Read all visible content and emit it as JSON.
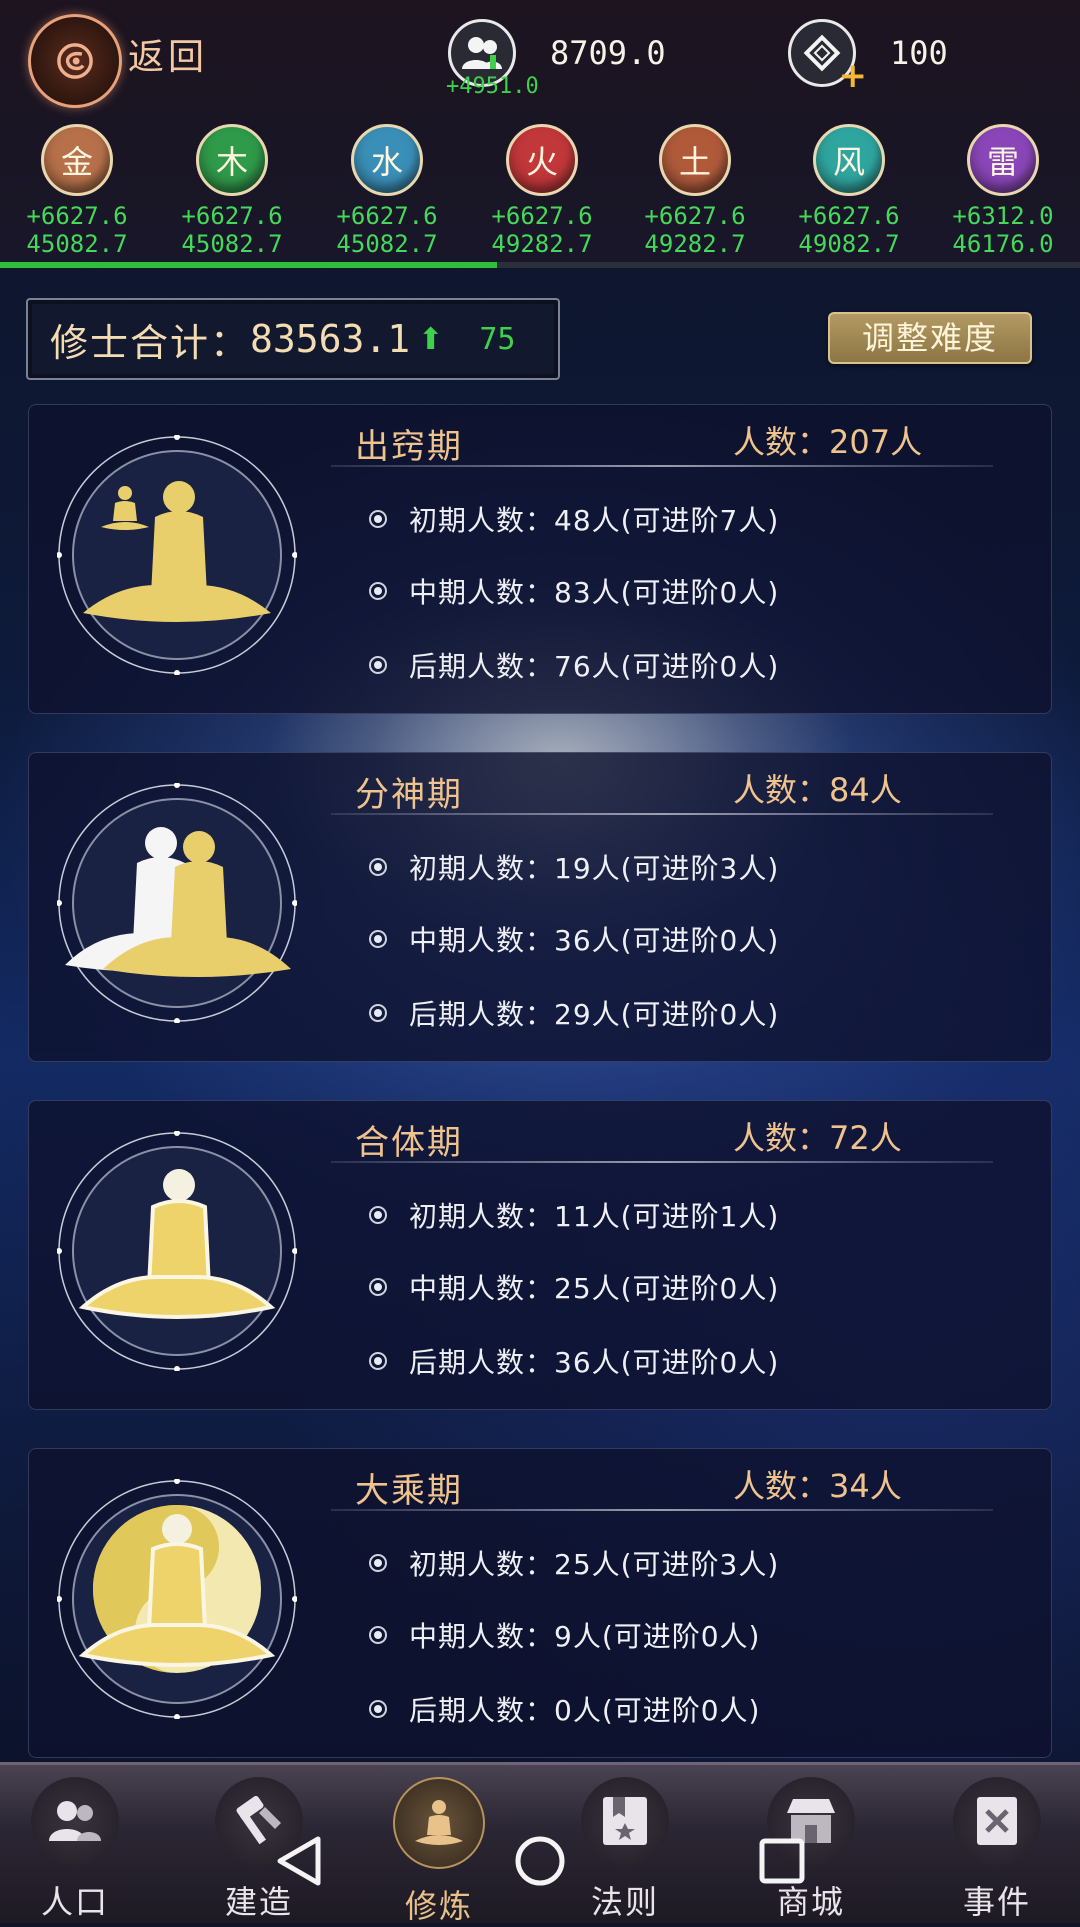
{
  "header": {
    "back_label": "返回",
    "population": "8709.0",
    "population_delta": "+4951.0",
    "currency": "100"
  },
  "elements": [
    {
      "name": "金",
      "delta": "+6627.6",
      "total": "45082.7",
      "color": "#b7714a"
    },
    {
      "name": "木",
      "delta": "+6627.6",
      "total": "45082.7",
      "color": "#2f9a4a"
    },
    {
      "name": "水",
      "delta": "+6627.6",
      "total": "45082.7",
      "color": "#3a8fb8"
    },
    {
      "name": "火",
      "delta": "+6627.6",
      "total": "49282.7",
      "color": "#c2373a"
    },
    {
      "name": "土",
      "delta": "+6627.6",
      "total": "49282.7",
      "color": "#b05a3a"
    },
    {
      "name": "风",
      "delta": "+6627.6",
      "total": "49082.7",
      "color": "#2fa5a0"
    },
    {
      "name": "雷",
      "delta": "+6312.0",
      "total": "46176.0",
      "color": "#8a46b8"
    }
  ],
  "progress_fraction": 0.46,
  "summary": {
    "label": "修士合计：",
    "value": "83563.1",
    "increase": "75",
    "adjust_label": "调整难度"
  },
  "stages": [
    {
      "title": "出窍期",
      "count": "人数：207人",
      "rows": [
        "初期人数：48人(可进阶7人)",
        "中期人数：83人(可进阶0人)",
        "后期人数：76人(可进阶0人)"
      ]
    },
    {
      "title": "分神期",
      "count": "人数：84人",
      "rows": [
        "初期人数：19人(可进阶3人)",
        "中期人数：36人(可进阶0人)",
        "后期人数：29人(可进阶0人)"
      ]
    },
    {
      "title": "合体期",
      "count": "人数：72人",
      "rows": [
        "初期人数：11人(可进阶1人)",
        "中期人数：25人(可进阶0人)",
        "后期人数：36人(可进阶0人)"
      ]
    },
    {
      "title": "大乘期",
      "count": "人数：34人",
      "rows": [
        "初期人数：25人(可进阶3人)",
        "中期人数：9人(可进阶0人)",
        "后期人数：0人(可进阶0人)"
      ]
    }
  ],
  "nav": [
    {
      "label": "人口",
      "icon": "population-icon"
    },
    {
      "label": "建造",
      "icon": "build-icon"
    },
    {
      "label": "修炼",
      "icon": "cultivate-icon"
    },
    {
      "label": "法则",
      "icon": "law-icon"
    },
    {
      "label": "商城",
      "icon": "shop-icon"
    },
    {
      "label": "事件",
      "icon": "event-icon"
    }
  ],
  "colors": {
    "accent_gold": "#efc38e",
    "positive_green": "#3ed14b",
    "figure_gold": "#e9cf6c"
  }
}
